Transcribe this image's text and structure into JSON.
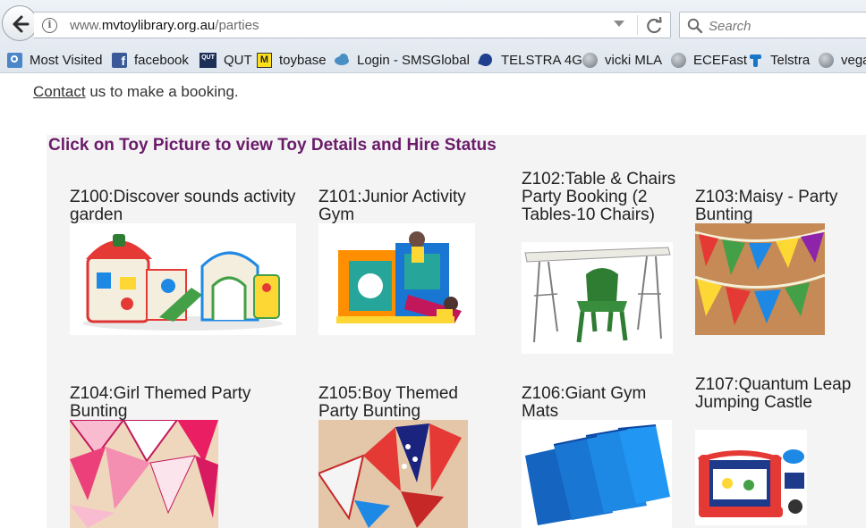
{
  "browser": {
    "url_prefix": "www.",
    "url_host": "mvtoylibrary.org.au",
    "url_path": "/parties",
    "search_placeholder": "Search",
    "bookmarks": [
      {
        "label": "Most Visited",
        "icon": "most-visited-icon"
      },
      {
        "label": "facebook",
        "icon": "facebook-icon"
      },
      {
        "label": "QUT",
        "icon": "qut-logo-icon"
      },
      {
        "label": "toybase",
        "icon": "toybase-icon"
      },
      {
        "label": "Login - SMSGlobal",
        "icon": "smsglobal-icon"
      },
      {
        "label": "TELSTRA 4G",
        "icon": "telstra-4g-icon"
      },
      {
        "label": "vicki MLA",
        "icon": "globe-icon"
      },
      {
        "label": "ECEFast",
        "icon": "globe-icon"
      },
      {
        "label": "Telstra",
        "icon": "telstra-icon"
      },
      {
        "label": "vega",
        "icon": "globe-icon"
      }
    ]
  },
  "page": {
    "contact_link": "Contact",
    "contact_rest": " us to make a booking.",
    "section_title": "Click on Toy Picture to view Toy Details and Hire Status",
    "toys": [
      {
        "name": "Z100:Discover sounds activity garden",
        "image": "activity-garden"
      },
      {
        "name": "Z101:Junior Activity Gym",
        "image": "activity-gym"
      },
      {
        "name": "Z102:Table & Chairs Party Booking (2 Tables-10 Chairs)",
        "image": "table-chairs"
      },
      {
        "name": "Z103:Maisy - Party Bunting",
        "image": "maisy-bunting"
      },
      {
        "name": "Z104:Girl Themed Party Bunting",
        "image": "girl-bunting"
      },
      {
        "name": "Z105:Boy Themed Party Bunting",
        "image": "boy-bunting"
      },
      {
        "name": "Z106:Giant Gym Mats",
        "image": "gym-mats"
      },
      {
        "name": "Z107:Quantum Leap Jumping Castle",
        "image": "jumping-castle"
      }
    ]
  },
  "colors": {
    "title_purple": "#6a1b6a",
    "panel_bg": "#f4f4f4"
  }
}
